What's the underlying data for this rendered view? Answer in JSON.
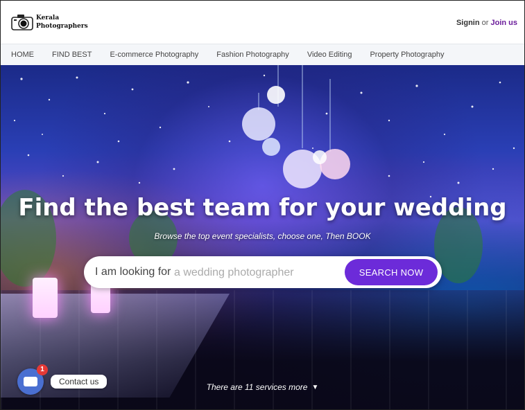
{
  "header": {
    "logo_line1": "Kerala",
    "logo_line2": "Photographers",
    "signin_label": "Signin",
    "or_label": "or",
    "joinus_label": "Join us"
  },
  "nav": {
    "items": [
      "HOME",
      "FIND BEST",
      "E-commerce Photography",
      "Fashion Photography",
      "Video Editing",
      "Property Photography"
    ]
  },
  "hero": {
    "title": "Find the best team for your wedding",
    "subtitle": "Browse the top event specialists, choose one, Then BOOK",
    "search_prefix": "I am looking for",
    "search_placeholder": "a wedding photographer",
    "search_button": "SEARCH NOW",
    "more_services": "There are 11 services more"
  },
  "contact": {
    "badge_count": "1",
    "label": "Contact us",
    "icon": "chat-icon"
  },
  "colors": {
    "accent": "#6c2bd9",
    "joinus": "#6a1b9a",
    "chat_button": "#4a6fd1",
    "badge": "#e53935"
  }
}
